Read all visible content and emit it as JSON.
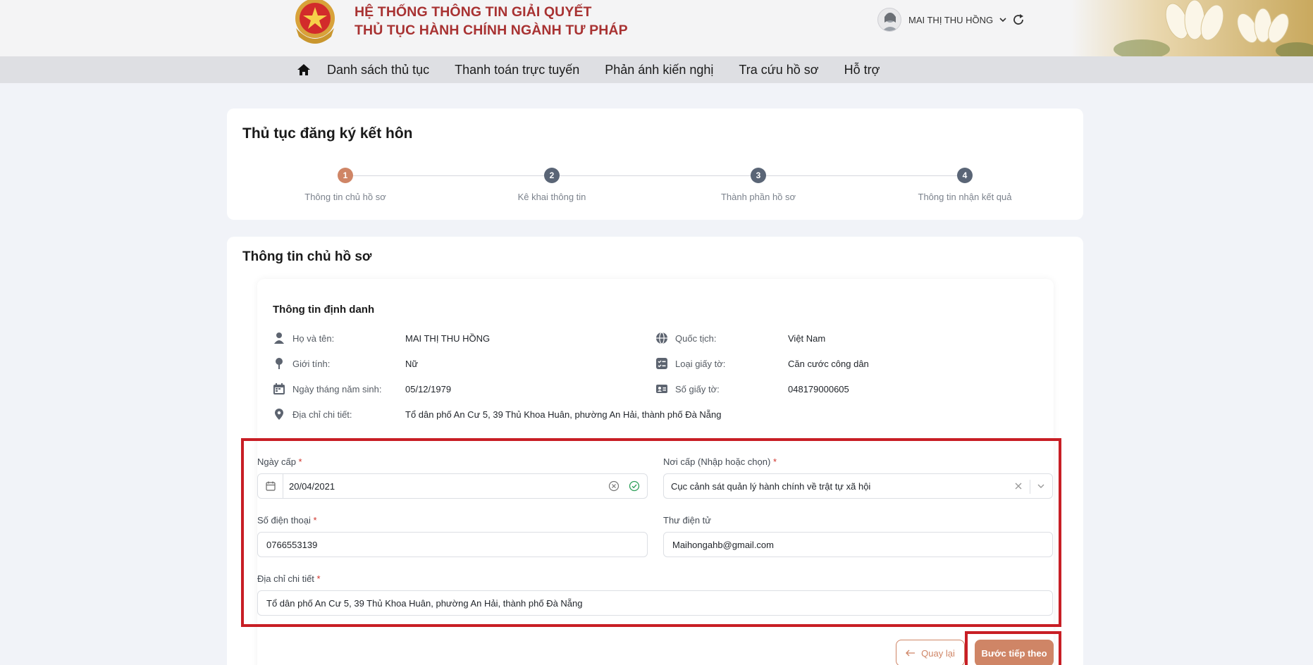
{
  "header": {
    "system_title_line1": "HỆ THỐNG THÔNG TIN GIẢI QUYẾT",
    "system_title_line2": "THỦ TỤC HÀNH CHÍNH NGÀNH TƯ PHÁP",
    "user_name": "MAI THỊ THU HỒNG"
  },
  "nav": {
    "items": [
      {
        "label": "Danh sách thủ tục"
      },
      {
        "label": "Thanh toán trực tuyến"
      },
      {
        "label": "Phản ánh kiến nghị"
      },
      {
        "label": "Tra cứu hồ sơ"
      },
      {
        "label": "Hỗ trợ"
      }
    ]
  },
  "page": {
    "title": "Thủ tục đăng ký kết hôn"
  },
  "stepper": {
    "active_step": 1,
    "steps": [
      {
        "num": "1",
        "label": "Thông tin chủ hồ sơ"
      },
      {
        "num": "2",
        "label": "Kê khai thông tin"
      },
      {
        "num": "3",
        "label": "Thành phần hồ sơ"
      },
      {
        "num": "4",
        "label": "Thông tin nhận kết quả"
      }
    ]
  },
  "section": {
    "title": "Thông tin chủ hồ sơ",
    "identity_title": "Thông tin định danh"
  },
  "identity": {
    "full_name": {
      "label": "Họ và tên:",
      "value": "MAI THỊ THU HỒNG"
    },
    "gender": {
      "label": "Giới tính:",
      "value": "Nữ"
    },
    "dob": {
      "label": "Ngày tháng năm sinh:",
      "value": "05/12/1979"
    },
    "address": {
      "label": "Địa chỉ chi tiết:",
      "value": "Tổ dân phố An Cư 5, 39 Thủ Khoa Huân, phường An Hải, thành phố Đà Nẵng"
    },
    "nationality": {
      "label": "Quốc tịch:",
      "value": "Việt Nam"
    },
    "doc_type": {
      "label": "Loại giấy tờ:",
      "value": "Căn cước công dân"
    },
    "doc_number": {
      "label": "Số giấy tờ:",
      "value": "048179000605"
    }
  },
  "form": {
    "issue_date": {
      "label": "Ngày cấp",
      "required": "*",
      "value": "20/04/2021"
    },
    "issue_place": {
      "label": "Nơi cấp (Nhập hoặc chọn)",
      "required": "*",
      "value": "Cục cảnh sát quản lý hành chính về trật tự xã hội"
    },
    "phone": {
      "label": "Số điện thoại",
      "required": "*",
      "value": "0766553139"
    },
    "email": {
      "label": "Thư điện tử",
      "value": "Maihongahb@gmail.com"
    },
    "address": {
      "label": "Địa chỉ chi tiết",
      "required": "*",
      "value": "Tổ dân phố An Cư 5, 39 Thủ Khoa Huân, phường An Hải, thành phố Đà Nẵng"
    }
  },
  "actions": {
    "back_label": "Quay lại",
    "next_label": "Bước tiếp theo"
  },
  "colors": {
    "accent": "#cf8566",
    "title_red": "#a83232",
    "highlight_red": "#c81e25",
    "step_inactive": "#5a6576"
  },
  "icons": [
    "emblem-logo",
    "avatar",
    "chevron-down-icon",
    "refresh-icon",
    "home-icon",
    "user-icon",
    "gender-icon",
    "calendar-icon",
    "location-icon",
    "globe-icon",
    "document-list-icon",
    "id-card-icon",
    "clear-icon",
    "check-circle-icon",
    "arrow-left-icon"
  ]
}
